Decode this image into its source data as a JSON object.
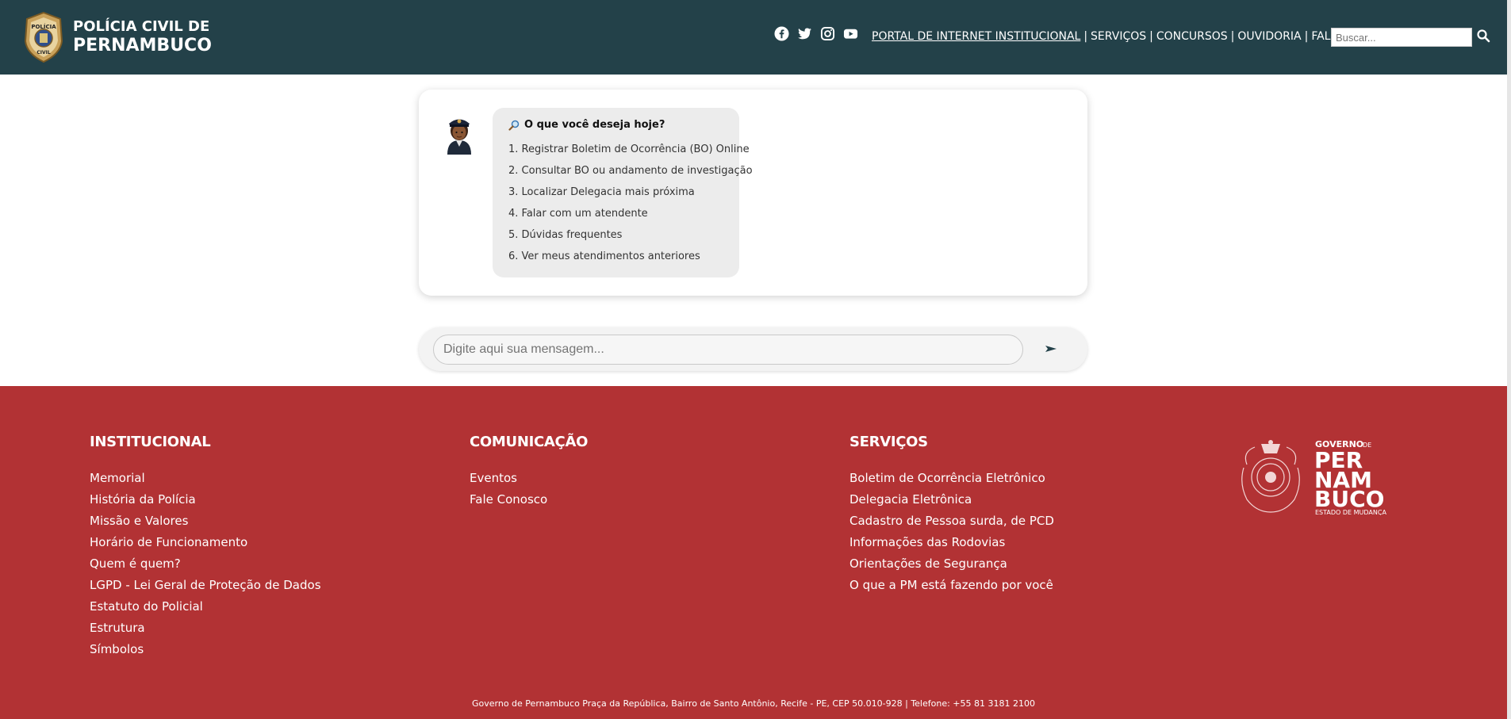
{
  "header": {
    "brand_line1": "POLÍCIA CIVIL DE",
    "brand_line2": "PERNAMBUCO",
    "badge_text_top": "POLÍCIA",
    "badge_text_bottom": "CIVIL",
    "social_icons": [
      "facebook-icon",
      "twitter-icon",
      "instagram-icon",
      "youtube-icon"
    ],
    "nav": {
      "portal": "PORTAL DE INTERNET INSTITUCIONAL",
      "servicos": "SERVIÇOS",
      "concursos": "CONCURSOS",
      "ouvidoria": "OUVIDORIA",
      "fale": "FALE CONOSCO",
      "separator": "|"
    },
    "search_placeholder": "Buscar..."
  },
  "chat": {
    "title": "O que você deseja hoje?",
    "options": [
      "1. Registrar Boletim de Ocorrência (BO) Online",
      "2. Consultar BO ou andamento de investigação",
      "3. Localizar Delegacia mais próxima",
      "4. Falar com um atendente",
      "5. Dúvidas frequentes",
      "6. Ver meus atendimentos anteriores"
    ],
    "input_placeholder": "Digite aqui sua mensagem..."
  },
  "footer": {
    "institucional": {
      "title": "INSTITUCIONAL",
      "items": [
        "Memorial",
        "História da Polícia",
        "Missão e Valores",
        "Horário de Funcionamento",
        "Quem é quem?",
        "LGPD - Lei Geral de Proteção de Dados",
        "Estatuto do Policial",
        "Estrutura",
        "Símbolos"
      ]
    },
    "comunicacao": {
      "title": "COMUNICAÇÃO",
      "items": [
        "Eventos",
        "Fale Conosco"
      ]
    },
    "servicos": {
      "title": "SERVIÇOS",
      "items": [
        "Boletim de Ocorrência Eletrônico",
        "Delegacia Eletrônica",
        "Cadastro de Pessoa surda, de PCD",
        "Informações das Rodovias",
        "Orientações de Segurança",
        "O que a PM está fazendo por você"
      ]
    },
    "gov_logo": {
      "governo": "GOVERNO",
      "de": "DE",
      "per": "PER",
      "nam": "NAM",
      "buco": "BUCO",
      "slogan": "ESTADO DE MUDANÇA"
    },
    "address": "Governo de Pernambuco Praça da República, Bairro de Santo Antônio, Recife - PE, CEP 50.010-928 | Telefone: +55 81 3181 2100"
  },
  "colors": {
    "header_bg": "#234149",
    "footer_bg": "#b23234",
    "bubble_bg": "#ececec"
  }
}
